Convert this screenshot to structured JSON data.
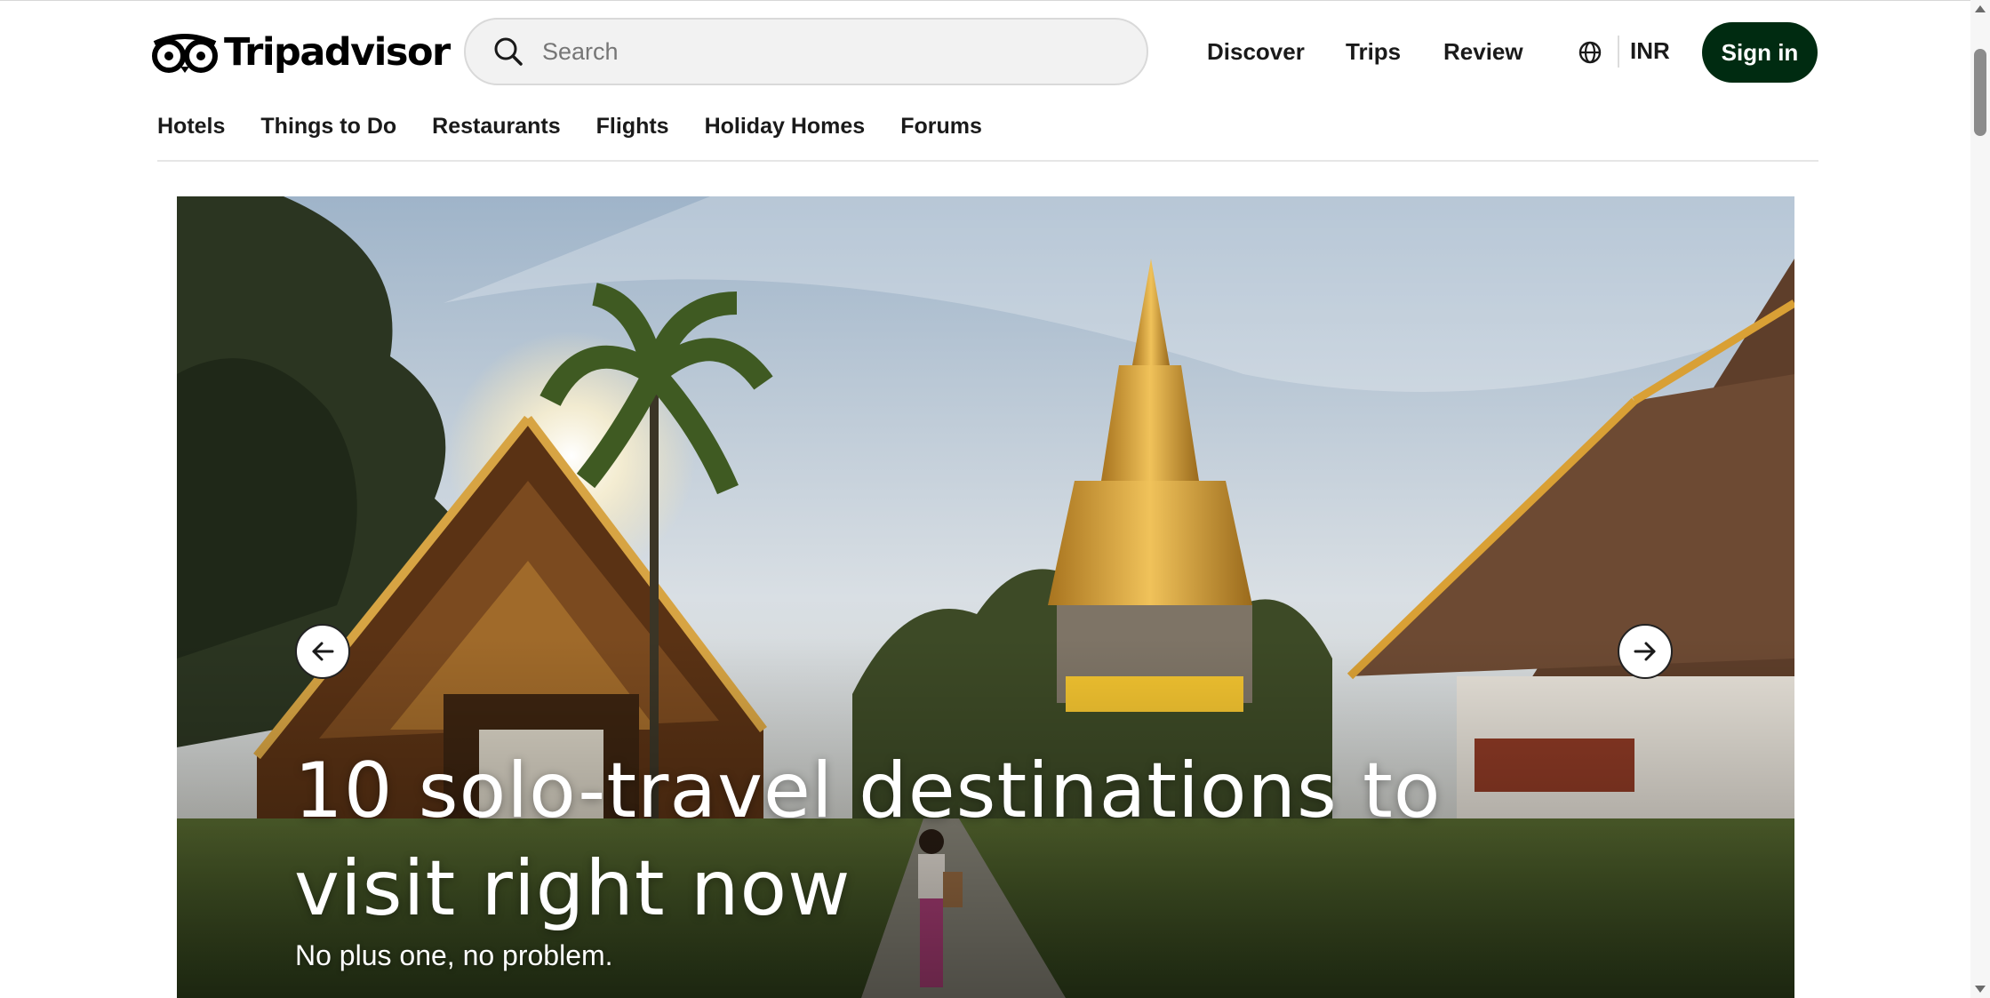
{
  "header": {
    "logo_text": "Tripadvisor",
    "search": {
      "placeholder": "Search",
      "value": ""
    },
    "nav": [
      "Discover",
      "Trips",
      "Review"
    ],
    "currency": "INR",
    "sign_in_label": "Sign in"
  },
  "subnav": [
    "Hotels",
    "Things to Do",
    "Restaurants",
    "Flights",
    "Holiday Homes",
    "Forums"
  ],
  "hero": {
    "title_line1": "10 solo-travel destinations to",
    "title_line2": "visit right now",
    "subtitle": "No plus one, no problem."
  },
  "colors": {
    "brand_dark": "#002b11",
    "nav_text": "#1a1a1a"
  },
  "icons": [
    "tripadvisor-owl-logo",
    "search-icon",
    "globe-icon",
    "arrow-left-icon",
    "arrow-right-icon"
  ]
}
